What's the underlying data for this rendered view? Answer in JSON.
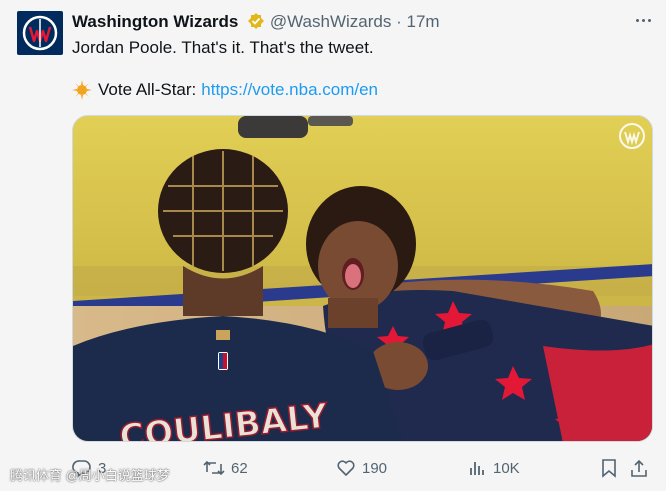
{
  "tweet": {
    "author_name": "Washington Wizards",
    "handle": "@WashWizards",
    "separator": "·",
    "time": "17m",
    "text_line1": "Jordan Poole. That's it. That's the tweet.",
    "text_line2_prefix": "Vote All-Star:",
    "link": "https://vote.nba.com/en",
    "media_jersey_text": "COULIBALY"
  },
  "actions": {
    "replies": "3",
    "retweets": "62",
    "likes": "190",
    "views": "10K"
  },
  "watermark_text": "腾讯体育 @周小白说篮球梦",
  "colors": {
    "brand_navy": "#002b5c",
    "brand_red": "#e31837",
    "link_blue": "#1d9bf0",
    "verified_gold": "#e2b719",
    "muted": "#536471"
  },
  "icons": [
    "wizards-logo-icon",
    "verified-badge-icon",
    "more-icon",
    "star-burst-icon",
    "reply-icon",
    "retweet-icon",
    "like-icon",
    "views-icon",
    "bookmark-icon",
    "share-icon"
  ]
}
